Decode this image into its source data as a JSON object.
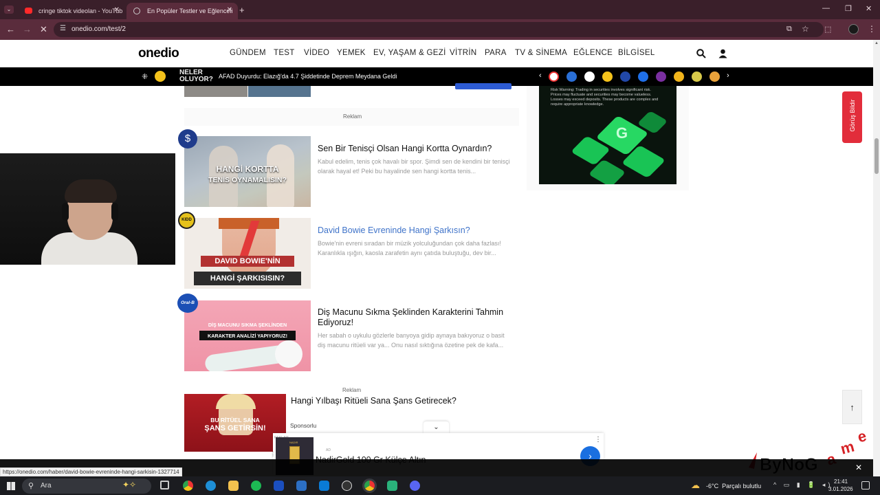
{
  "browser": {
    "tabs": [
      {
        "title": "cringe tiktok videolan - YouTub"
      },
      {
        "title": "En Popüler Testler ve Eğlenceli"
      }
    ],
    "url": "onedio.com/test/2",
    "status_url": "https://onedio.com/haber/david-bowie-evreninde-hangi-sarkisin-1327714"
  },
  "site": {
    "logo": "onedio",
    "menu": [
      "GÜNDEM",
      "TEST",
      "VİDEO",
      "YEMEK",
      "EV, YAŞAM & GEZİ",
      "VİTRİN",
      "PARA",
      "TV & SİNEMA",
      "EĞLENCE",
      "BİLGİSEL"
    ]
  },
  "ticker": {
    "label_line1": "NELER",
    "label_line2": "OLUYOR?",
    "headline": "AFAD Duyurdu: Elazığ'da 4.7 Şiddetinde Deprem Meydana Geldi"
  },
  "content": {
    "reklam_label": "Reklam",
    "cards": [
      {
        "title": "Sen Bir Tenisçi Olsan Hangi Kortta Oynardın?",
        "desc": "Kabul edelim, tenis çok havalı bir spor. Şimdi sen de kendini bir tenisçi olarak hayal et! Peki bu hayalinde sen hangi kortta tenis...",
        "thumb_line1": "HANGİ KORTTA",
        "thumb_line2": "TENİS OYNAMALISIN?",
        "badge_symbol": "$"
      },
      {
        "title": "David Bowie Evreninde Hangi Şarkısın?",
        "desc": "Bowie'nin evreni sıradan bir müzik yolculuğundan çok daha fazlası! Karanlıkla ışığın, kaosla zarafetin aynı çatıda buluştuğu, dev bir...",
        "thumb_line1": "DAVID BOWIE'NİN",
        "thumb_line2": "HANGİ ŞARKISISIN?",
        "badge_symbol": "KIDD"
      },
      {
        "title": "Diş Macunu Sıkma Şeklinden Karakterini Tahmin Ediyoruz!",
        "desc": "Her sabah o uykulu gözlerle banyoya gidip aynaya bakıyoruz o basit diş macunu ritüeli var ya... Onu nasıl sıktığına özetine pek de kafa...",
        "thumb_line1": "DİŞ MACUNU SIKMA ŞEKLİNDEN",
        "thumb_line2": "KARAKTER ANALİZİ YAPIYORUZ!",
        "badge_symbol": "Oral-B"
      }
    ],
    "sponsored": {
      "reklam": "Reklam",
      "title": "Hangi Yılbaşı Ritüeli Sana Şans Getirecek?",
      "label": "Sponsorlu",
      "thumb_line1": "BU RİTÜEL SANA",
      "thumb_line2": "ŞANS GETİRSİN!"
    }
  },
  "sidebar": {
    "ad_warning": "Risk Warning: Trading in securities involves significant risk. Prices may fluctuate and securities may become valueless. Losses may exceed deposits. These products are complex and require appropriate knowledge."
  },
  "feedback": {
    "label": "Görüş Bildir"
  },
  "bottom_ad": {
    "tag": "AD",
    "reklam": "REKLAM",
    "title": "NadirGold 100 Gr Külçe Altın",
    "brand": "NADIR"
  },
  "watermark": "ByNoGame",
  "taskbar": {
    "search_placeholder": "Ara",
    "weather": "-6°C  Parçalı bulutlu",
    "time": "21:41",
    "date": "3.01.2026"
  },
  "colors": {
    "tab_bg": "#3a1f2a",
    "toolbar_bg": "#5a2c3c",
    "accent_red": "#e22d3b",
    "ad_green": "#19c455"
  }
}
